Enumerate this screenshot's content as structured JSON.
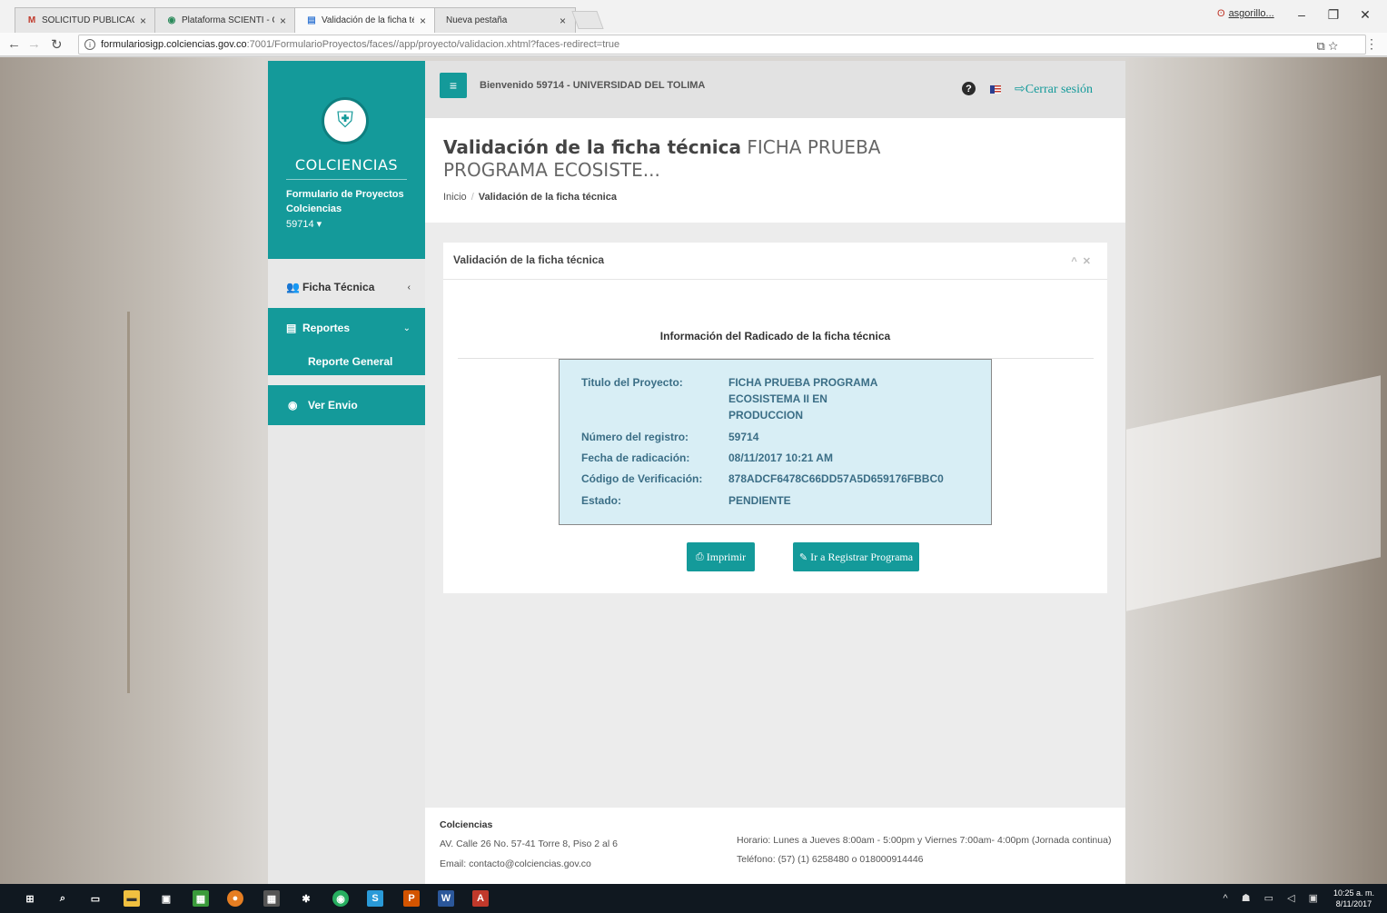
{
  "browser": {
    "tabs": [
      {
        "icon": "gmail-icon",
        "title": "SOLICITUD PUBLICACIÓ",
        "active": false
      },
      {
        "icon": "scienti-icon",
        "title": "Plataforma SCIENTI - Co",
        "active": false
      },
      {
        "icon": "page-icon",
        "title": "Validación de la ficha téc",
        "active": true
      },
      {
        "icon": "none",
        "title": "Nueva pestaña",
        "active": false
      }
    ],
    "profile_name": "asgorillo...",
    "url_host": "formulariosigp.colciencias.gov.co",
    "url_path": ":7001/FormularioProyectos/faces//app/proyecto/validacion.xhtml?faces-redirect=true"
  },
  "sidebar": {
    "brand": "COLCIENCIAS",
    "subtitle": "Formulario de Proyectos Colciencias",
    "account_id": "59714 ▾",
    "items": [
      {
        "label": "Ficha Técnica",
        "icon": "users-icon",
        "arrow": "‹"
      },
      {
        "label": "Reportes",
        "icon": "file-icon",
        "arrow": "⌄"
      },
      {
        "label": "Reporte General"
      },
      {
        "label": "Ver Envio",
        "icon": "eye-icon"
      }
    ]
  },
  "topbar": {
    "welcome": "Bienvenido 59714 - UNIVERSIDAD DEL TOLIMA",
    "logout_label": "Cerrar sesión"
  },
  "header": {
    "title_bold": "Validación de la ficha técnica",
    "title_sub": "FICHA PRUEBA PROGRAMA ECOSISTE...",
    "breadcrumb_home": "Inicio",
    "breadcrumb_current": "Validación de la ficha técnica"
  },
  "panel": {
    "title": "Validación de la ficha técnica",
    "info_title": "Información del Radicado de la ficha técnica",
    "rows": [
      {
        "label": "Titulo del Proyecto:",
        "value": "FICHA PRUEBA PROGRAMA ECOSISTEMA II EN PRODUCCION"
      },
      {
        "label": "Número del registro:",
        "value": "59714"
      },
      {
        "label": "Fecha de radicación:",
        "value": "08/11/2017 10:21 AM"
      },
      {
        "label": "Código de Verificación:",
        "value": "878ADCF6478C66DD57A5D659176FBBC0"
      },
      {
        "label": "Estado:",
        "value": "PENDIENTE"
      }
    ],
    "print_label": "Imprimir",
    "register_label": "Ir a Registrar Programa"
  },
  "footer": {
    "org": "Colciencias",
    "address": "AV. Calle 26 No. 57-41 Torre 8, Piso 2 al 6",
    "email": "Email: contacto@colciencias.gov.co",
    "hours": "Horario: Lunes a Jueves 8:00am - 5:00pm y Viernes 7:00am- 4:00pm (Jornada continua)",
    "phone": "Teléfono: (57) (1) 6258480 o 018000914446"
  },
  "taskbar": {
    "time": "10:25 a. m.",
    "date": "8/11/2017"
  },
  "colors": {
    "accent": "#149a9a",
    "info_box": "#d8eef5",
    "info_text": "#3b6e86"
  }
}
